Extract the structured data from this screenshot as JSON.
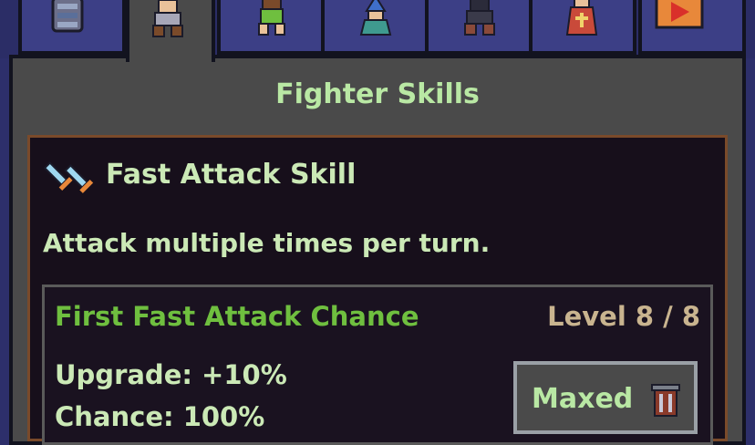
{
  "tabs": [
    {
      "name": "armor-tab",
      "icon": "armor-icon"
    },
    {
      "name": "fighter-tab",
      "icon": "fighter-icon",
      "active": true
    },
    {
      "name": "ranger-tab",
      "icon": "ranger-icon"
    },
    {
      "name": "mage-tab",
      "icon": "mage-icon"
    },
    {
      "name": "rogue-tab",
      "icon": "rogue-icon"
    },
    {
      "name": "priest-tab",
      "icon": "priest-icon"
    },
    {
      "name": "exit-tab",
      "icon": "exit-icon"
    }
  ],
  "panel": {
    "title": "Fighter Skills"
  },
  "skill": {
    "icon": "twin-swords-icon",
    "name": "Fast Attack Skill",
    "description": "Attack multiple times per turn."
  },
  "upgrade": {
    "name": "First Fast Attack Chance",
    "level": "Level 8 / 8",
    "upgrade_text": "Upgrade: +10%",
    "chance_text": "Chance: 100%",
    "button_label": "Maxed",
    "button_icon": "trash-bin-icon"
  },
  "colors": {
    "title_green": "#b9e8a4",
    "upgrade_green": "#6fbf3f",
    "level_tan": "#c9b48f",
    "panel_gray": "#4a4a4a",
    "box_dark": "#170f1b"
  }
}
